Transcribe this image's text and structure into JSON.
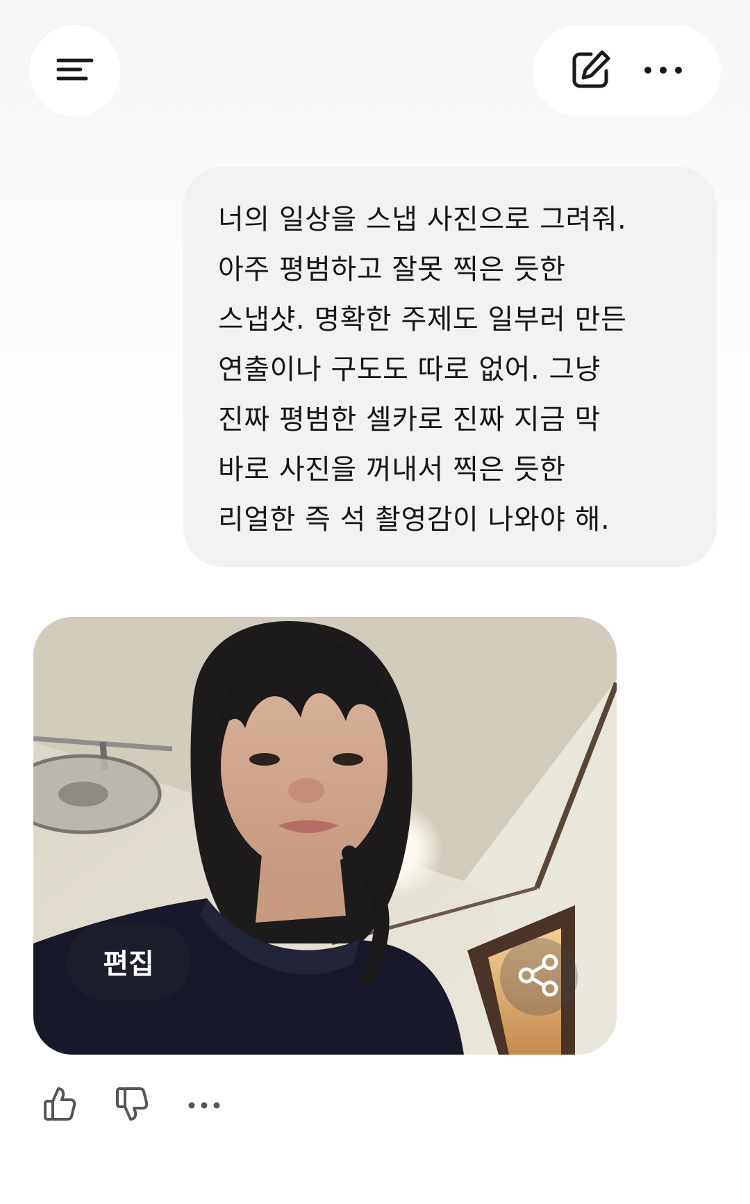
{
  "header": {
    "menu_icon": "menu-lines-icon",
    "new_chat_icon": "edit-pencil-icon",
    "more_icon": "more-horizontal-icon"
  },
  "conversation": {
    "user_message": "너의 일상을 스냅 사진으로 그려줘.\n아주 평범하고 잘못 찍은 듯한\n스냅샷. 명확한 주제도 일부러 만든\n연출이나 구도도 따로 없어. 그냥\n진짜 평범한 셀카로 진짜 지금 막\n바로 사진을 꺼내서 찍은 듯한\n리얼한 즉 석 촬영감이 나와야 해.",
    "image_card": {
      "edit_label": "편집",
      "share_icon": "share-icon"
    },
    "feedback": {
      "like_icon": "thumbs-up-icon",
      "dislike_icon": "thumbs-down-icon",
      "more_icon": "more-horizontal-icon"
    }
  },
  "colors": {
    "bubble_bg": "#f2f2f2",
    "icon_dark": "#1a1a1a",
    "icon_gray": "#555555"
  }
}
